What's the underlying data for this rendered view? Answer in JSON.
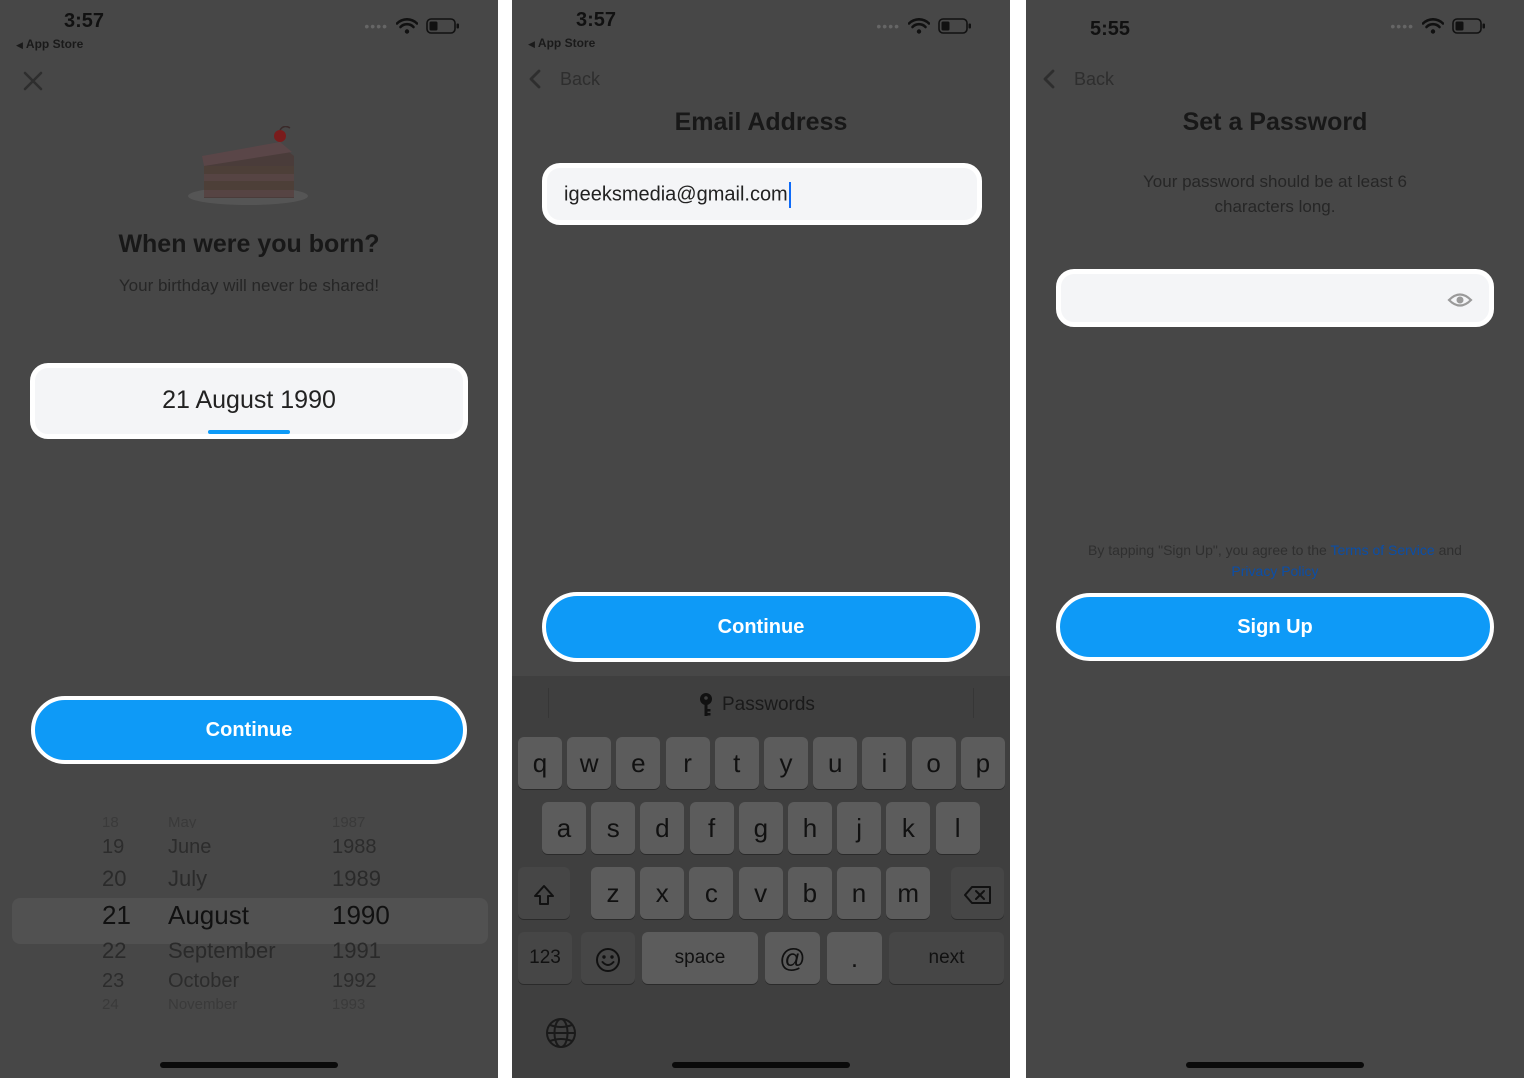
{
  "screen1": {
    "time": "3:57",
    "back_app": "App Store",
    "title": "When were you born?",
    "subtitle": "Your birthday will never be shared!",
    "date_value": "21 August 1990",
    "continue_label": "Continue",
    "picker": {
      "days": [
        "18",
        "19",
        "20",
        "21",
        "22",
        "23",
        "24"
      ],
      "months": [
        "May",
        "June",
        "July",
        "August",
        "September",
        "October",
        "November"
      ],
      "years": [
        "1987",
        "1988",
        "1989",
        "1990",
        "1991",
        "1992",
        "1993"
      ],
      "selected_index": 3
    }
  },
  "screen2": {
    "time": "3:57",
    "back_app": "App Store",
    "back_label": "Back",
    "title": "Email Address",
    "email_value": "igeeksmedia@gmail.com",
    "continue_label": "Continue",
    "keyboard": {
      "bar_label": "Passwords",
      "row1": [
        "q",
        "w",
        "e",
        "r",
        "t",
        "y",
        "u",
        "i",
        "o",
        "p"
      ],
      "row2": [
        "a",
        "s",
        "d",
        "f",
        "g",
        "h",
        "j",
        "k",
        "l"
      ],
      "row3": [
        "z",
        "x",
        "c",
        "v",
        "b",
        "n",
        "m"
      ],
      "num_label": "123",
      "space_label": "space",
      "at_label": "@",
      "dot_label": ".",
      "next_label": "next"
    }
  },
  "screen3": {
    "time": "5:55",
    "back_label": "Back",
    "title": "Set a Password",
    "subtitle_line1": "Your password should be at least 6",
    "subtitle_line2": "characters long.",
    "password_value": "",
    "legal_prefix": "By tapping \"Sign Up\", you agree to the ",
    "terms_label": "Terms of Service",
    "legal_and": " and",
    "privacy_label": "Privacy Policy",
    "signup_label": "Sign Up"
  },
  "colors": {
    "accent": "#0e9af7",
    "overlay_bg": "#474747",
    "link": "#0a4ea8"
  },
  "icons": [
    "close-icon",
    "chevron-left-icon",
    "wifi-icon",
    "battery-icon",
    "cake-icon",
    "eye-icon",
    "key-icon",
    "shift-icon",
    "backspace-icon",
    "emoji-icon",
    "globe-icon"
  ]
}
